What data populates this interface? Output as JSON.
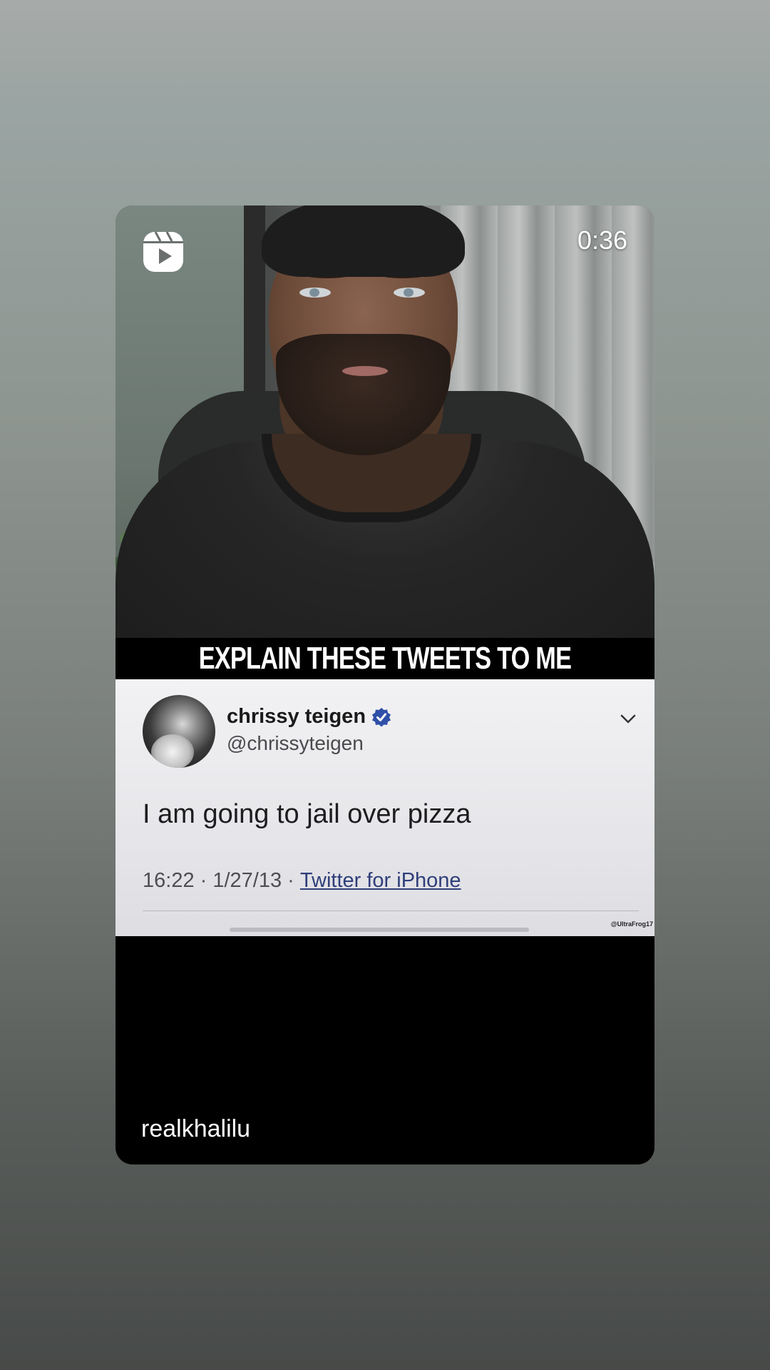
{
  "story": {
    "timer": "0:36",
    "username": "realkhalilu"
  },
  "video": {
    "headline": "EXPLAIN THESE TWEETS TO ME"
  },
  "tweet": {
    "display_name": "chrissy teigen",
    "handle": "@chrissyteigen",
    "text": "I am going to jail over pizza",
    "time": "16:22",
    "date": "1/27/13",
    "separator": " · ",
    "source": "Twitter for iPhone",
    "watermark": "@UltraFrog17",
    "verified_color": "#2f4fa8"
  },
  "icons": {
    "reels": "reels-icon",
    "verified": "verified-badge-icon",
    "chevron": "chevron-down-icon"
  }
}
